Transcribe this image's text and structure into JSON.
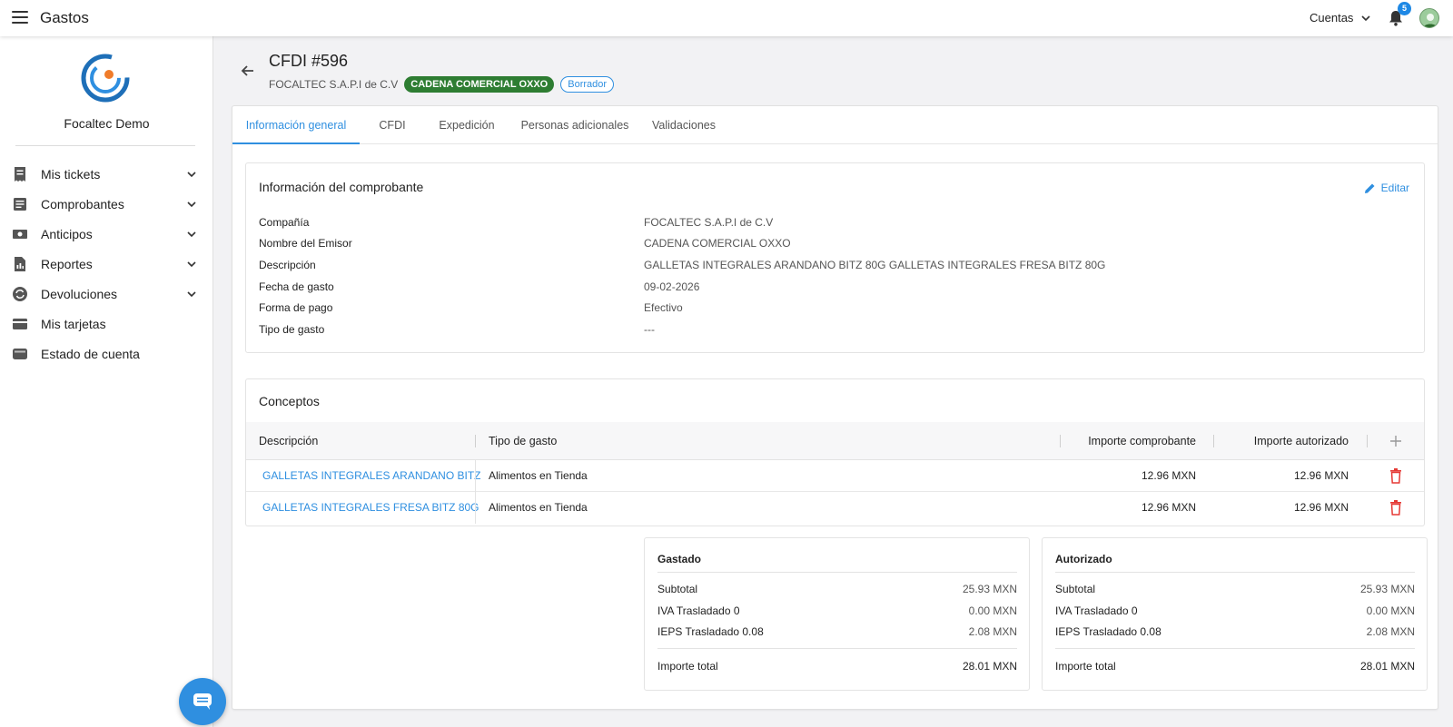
{
  "topbar": {
    "app_title": "Gastos",
    "accounts_label": "Cuentas",
    "notification_count": "5"
  },
  "sidebar": {
    "company": "Focaltec Demo",
    "items": [
      {
        "label": "Mis tickets",
        "icon": "receipt-icon",
        "expandable": true
      },
      {
        "label": "Comprobantes",
        "icon": "document-icon",
        "expandable": true
      },
      {
        "label": "Anticipos",
        "icon": "cash-icon",
        "expandable": true
      },
      {
        "label": "Reportes",
        "icon": "report-icon",
        "expandable": true
      },
      {
        "label": "Devoluciones",
        "icon": "refund-icon",
        "expandable": true
      },
      {
        "label": "Mis tarjetas",
        "icon": "credit-card-icon",
        "expandable": false
      },
      {
        "label": "Estado de cuenta",
        "icon": "wallet-icon",
        "expandable": false
      }
    ]
  },
  "header": {
    "title": "CFDI #596",
    "company": "FOCALTEC S.A.P.I de C.V",
    "issuer_chip": "CADENA COMERCIAL OXXO",
    "status_chip": "Borrador"
  },
  "tabs": [
    {
      "label": "Información general",
      "active": true
    },
    {
      "label": "CFDI",
      "active": false
    },
    {
      "label": "Expedición",
      "active": false
    },
    {
      "label": "Personas adicionales",
      "active": false
    },
    {
      "label": "Validaciones",
      "active": false
    }
  ],
  "info": {
    "title": "Información del comprobante",
    "edit_label": "Editar",
    "rows": [
      {
        "label": "Compañía",
        "value": "FOCALTEC S.A.P.I de C.V"
      },
      {
        "label": "Nombre del Emisor",
        "value": "CADENA COMERCIAL OXXO"
      },
      {
        "label": "Descripción",
        "value": "GALLETAS INTEGRALES ARANDANO BITZ 80G GALLETAS INTEGRALES FRESA BITZ 80G"
      },
      {
        "label": "Fecha de gasto",
        "value": "09-02-2026"
      },
      {
        "label": "Forma de pago",
        "value": "Efectivo"
      },
      {
        "label": "Tipo de gasto",
        "value": "---"
      }
    ]
  },
  "concepts": {
    "title": "Conceptos",
    "columns": [
      "Descripción",
      "Tipo de gasto",
      "Importe comprobante",
      "Importe autorizado"
    ],
    "rows": [
      {
        "description": "GALLETAS INTEGRALES ARANDANO BITZ",
        "type": "Alimentos en Tienda",
        "amount": "12.96 MXN",
        "authorized": "12.96 MXN"
      },
      {
        "description": "GALLETAS INTEGRALES FRESA BITZ 80G",
        "type": "Alimentos en Tienda",
        "amount": "12.96 MXN",
        "authorized": "12.96 MXN"
      }
    ]
  },
  "totals": [
    {
      "title": "Gastado",
      "rows": [
        {
          "label": "Subtotal",
          "value": "25.93 MXN"
        },
        {
          "label": "IVA Trasladado 0",
          "value": "0.00 MXN"
        },
        {
          "label": "IEPS Trasladado 0.08",
          "value": "2.08 MXN"
        }
      ],
      "total_label": "Importe total",
      "total_value": "28.01 MXN"
    },
    {
      "title": "Autorizado",
      "rows": [
        {
          "label": "Subtotal",
          "value": "25.93 MXN"
        },
        {
          "label": "IVA Trasladado 0",
          "value": "0.00 MXN"
        },
        {
          "label": "IEPS Trasladado 0.08",
          "value": "2.08 MXN"
        }
      ],
      "total_label": "Importe total",
      "total_value": "28.01 MXN"
    }
  ],
  "colors": {
    "accent": "#2f8fe0",
    "issuer_chip_bg": "#2e7d32",
    "delete": "#e53935"
  }
}
